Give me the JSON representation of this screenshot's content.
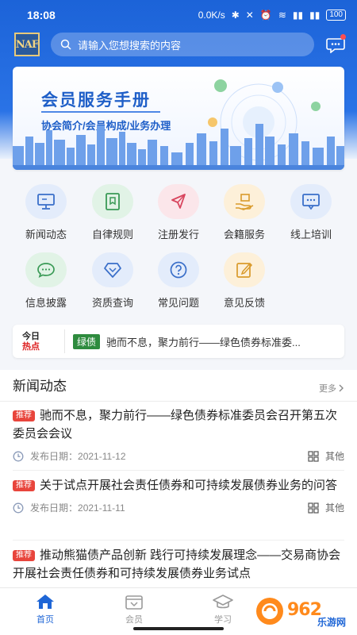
{
  "status_bar": {
    "time": "18:08",
    "network_speed": "0.0K/s",
    "battery": "100"
  },
  "header": {
    "logo_text": "NAFMII",
    "search_placeholder": "请输入您想搜索的内容"
  },
  "banner": {
    "title": "会员服务手册",
    "subtitle": "协会简介/会员构成/业务办理"
  },
  "menu": [
    {
      "label": "新闻动态",
      "icon": "monitor-icon",
      "color": "#e3ecfb"
    },
    {
      "label": "自律规则",
      "icon": "rulebook-icon",
      "color": "#e1f3e6"
    },
    {
      "label": "注册发行",
      "icon": "send-icon",
      "color": "#fbe6ea"
    },
    {
      "label": "会籍服务",
      "icon": "hand-box-icon",
      "color": "#fdf0d9"
    },
    {
      "label": "线上培训",
      "icon": "chat-screen-icon",
      "color": "#e3ecfb"
    },
    {
      "label": "信息披露",
      "icon": "speech-bubble-icon",
      "color": "#e1f3e6"
    },
    {
      "label": "资质查询",
      "icon": "diamond-icon",
      "color": "#e3ecfb"
    },
    {
      "label": "常见问题",
      "icon": "question-icon",
      "color": "#e3ecfb"
    },
    {
      "label": "意见反馈",
      "icon": "edit-icon",
      "color": "#fdf0d9"
    }
  ],
  "ticker": {
    "logo_line1": "今日",
    "logo_line2": "热点",
    "tag": "绿债",
    "text": "驰而不息，聚力前行——绿色债券标准委..."
  },
  "news_section": {
    "title": "新闻动态",
    "more": "更多"
  },
  "news": [
    {
      "tag": "推荐",
      "title": "驰而不息，聚力前行——绿色债券标准委员会召开第五次委员会会议",
      "date_label": "发布日期：",
      "date": "2021-11-12",
      "category": "其他"
    },
    {
      "tag": "推荐",
      "title": "关于试点开展社会责任债券和可持续发展债券业务的问答",
      "date_label": "发布日期：",
      "date": "2021-11-11",
      "category": "其他"
    },
    {
      "tag": "推荐",
      "title": "推动熊猫债产品创新 践行可持续发展理念——交易商协会开展社会责任债券和可持续发展债券业务试点",
      "date_label": "",
      "date": "",
      "category": ""
    }
  ],
  "tabs": [
    {
      "label": "首页",
      "icon": "home-icon",
      "active": true
    },
    {
      "label": "会员",
      "icon": "member-icon",
      "active": false
    },
    {
      "label": "学习",
      "icon": "graduation-cap-icon",
      "active": false
    }
  ],
  "watermark": {
    "text": "962",
    "sub": "乐游网"
  },
  "colors": {
    "primary": "#1f66d6",
    "tag_red": "#e8453c",
    "green_tag": "#2e8b3e"
  }
}
